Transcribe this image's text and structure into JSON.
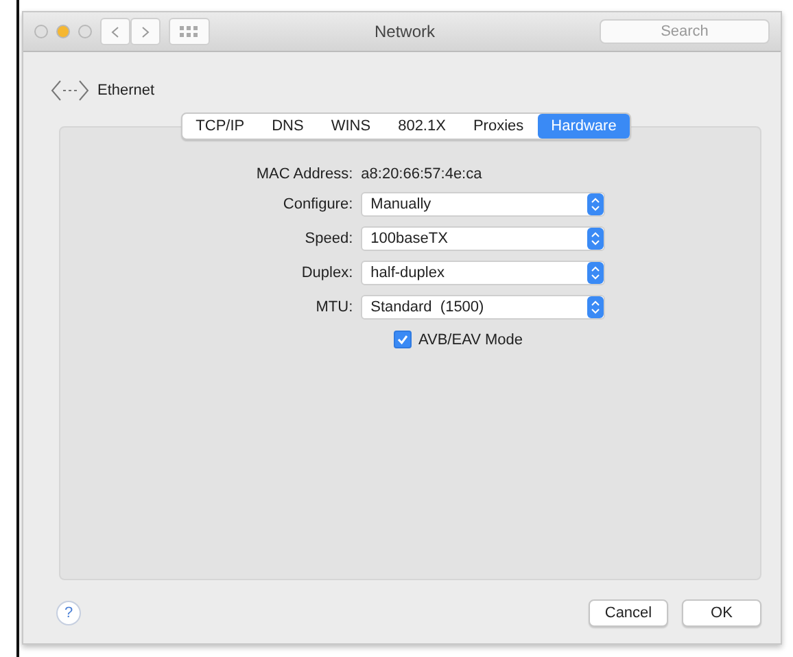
{
  "window": {
    "title": "Network"
  },
  "search": {
    "placeholder": "Search"
  },
  "service": {
    "name": "Ethernet"
  },
  "tabs": [
    {
      "label": "TCP/IP",
      "selected": false
    },
    {
      "label": "DNS",
      "selected": false
    },
    {
      "label": "WINS",
      "selected": false
    },
    {
      "label": "802.1X",
      "selected": false
    },
    {
      "label": "Proxies",
      "selected": false
    },
    {
      "label": "Hardware",
      "selected": true
    }
  ],
  "fields": [
    {
      "kind": "text",
      "label": "MAC Address:",
      "value": "a8:20:66:57:4e:ca"
    },
    {
      "kind": "popup",
      "label": "Configure:",
      "value": "Manually"
    },
    {
      "kind": "popup",
      "label": "Speed:",
      "value": "100baseTX"
    },
    {
      "kind": "popup",
      "label": "Duplex:",
      "value": "half-duplex"
    },
    {
      "kind": "popup",
      "label": "MTU:",
      "value": "Standard  (1500)"
    }
  ],
  "checkbox": {
    "label": "AVB/EAV Mode",
    "checked": true
  },
  "help": {
    "label": "?"
  },
  "buttons": [
    {
      "label": "Cancel"
    },
    {
      "label": "OK"
    }
  ]
}
